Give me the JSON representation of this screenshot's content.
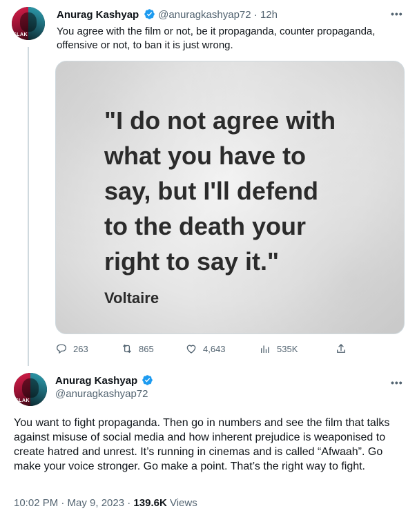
{
  "colors": {
    "text_primary": "#0f1419",
    "text_secondary": "#536471",
    "verified_blue": "#1d9bf0",
    "border": "#cfd9de"
  },
  "tweet1": {
    "author_name": "Anurag Kashyap",
    "handle": "@anuragkashyap72",
    "separator": " · ",
    "time_ago": "12h",
    "more_icon": "more-dots-icon",
    "text": "You agree with the film or not, be it propaganda, counter propaganda, offensive or not, to ban it is just wrong.",
    "media": {
      "quote_lines": [
        "\"I do not agree with",
        "what you have to",
        "say, but I'll defend",
        "to the death your",
        "right to say it.\""
      ],
      "author": "Voltaire"
    },
    "actions": {
      "replies": "263",
      "retweets": "865",
      "likes": "4,643",
      "views": "535K"
    }
  },
  "tweet2": {
    "author_name": "Anurag Kashyap",
    "handle": "@anuragkashyap72",
    "text": "You want to fight propaganda. Then go in numbers and see the film that talks against misuse of social media and how inherent prejudice is weaponised to create hatred and unrest. It’s running in cinemas and is called “Afwaah”. Go make your voice stronger. Go make a point. That’s the right way to fight.",
    "timestamp": "10:02 PM · May 9, 2023 · ",
    "views_count": "139.6K",
    "views_label": " Views"
  },
  "avatar": {
    "tag_text": "SLAK"
  }
}
